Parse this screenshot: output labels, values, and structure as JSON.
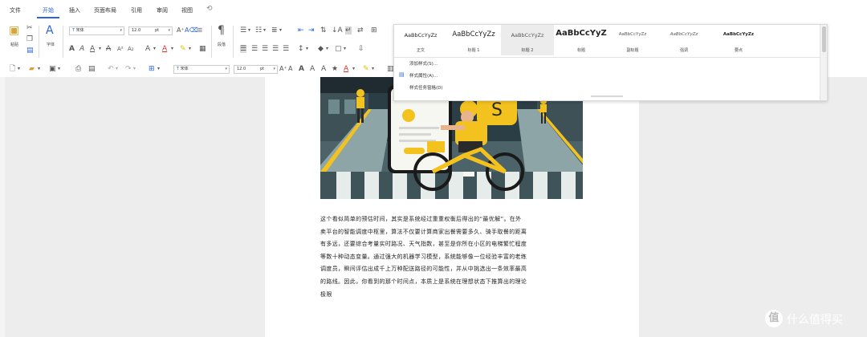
{
  "menu": {
    "file": "文件",
    "tabs": [
      "开始",
      "插入",
      "页面布局",
      "引用",
      "审阅",
      "视图"
    ],
    "more_icon": "more-icon"
  },
  "ribbon": {
    "paste_label": "粘贴",
    "format_painter_label": "格式刷",
    "font_label": "字体",
    "font_name": "宋体",
    "font_size": "12.0",
    "size_unit": "pt",
    "paragraph_label": "段落",
    "font_name_2": "宋体",
    "font_size_2": "12.0",
    "size_unit_2": "pt"
  },
  "styles": {
    "samples": [
      {
        "preview": "AaBbCcYyZz",
        "name": "正文"
      },
      {
        "preview": "AaBbCcYyZz",
        "name": "标题 1"
      },
      {
        "preview": "AaBbCcYyZz",
        "name": "标题 2"
      },
      {
        "preview": "AaBbCcYyZ",
        "name": "标题"
      },
      {
        "preview": "AaBbCcYyZz",
        "name": "副标题"
      },
      {
        "preview": "AaBbCcYyZz",
        "name": "强调"
      },
      {
        "preview": "AaBbCcYyZz",
        "name": "要点"
      }
    ],
    "options": [
      "添加样式(S)...",
      "样式属性(A)...",
      "样式任务窗格(D)"
    ]
  },
  "document": {
    "lines": [
      "这个看似简单的预估时间，其实是系统经过重重权衡后得出的“最优解”。在外",
      "卖平台的智能调度中枢里，算法不仅要计算商家出餐需要多久、骑手取餐的距离",
      "有多远，还要综合考量实时路况、天气指数，甚至是你所在小区的电梯繁忙程度",
      "等数十种动态变量。通过强大的机器学习模型，系统能够像一位经验丰富的老练",
      "调度员，瞬间评估出成千上万种配送路径的可能性，并从中挑选出一条效率最高",
      "的路线。因此，你看到的那个时间点，本质上是系统在理想状态下推算出的理论",
      "极限"
    ]
  },
  "watermark": {
    "logo": "值",
    "text": "什么值得买"
  }
}
